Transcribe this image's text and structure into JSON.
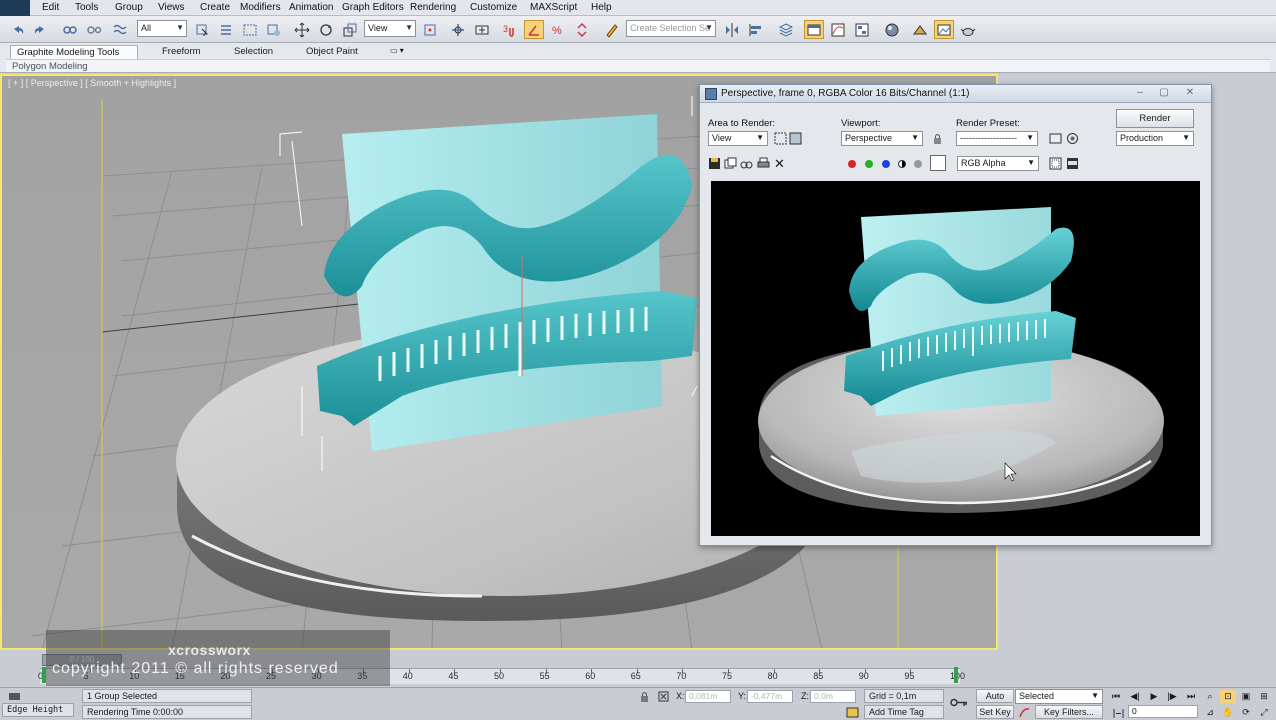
{
  "menu": [
    "Edit",
    "Tools",
    "Group",
    "Views",
    "Create",
    "Modifiers",
    "Animation",
    "Graph Editors",
    "Rendering",
    "Customize",
    "MAXScript",
    "Help"
  ],
  "toolbar": {
    "selection_filter": "All",
    "reference_coord": "View",
    "named_selection_placeholder": "Create Selection Se"
  },
  "ribbon": {
    "tabs": [
      "Graphite Modeling Tools",
      "Freeform",
      "Selection",
      "Object Paint"
    ],
    "panel_label": "Polygon Modeling"
  },
  "viewport": {
    "label": "[ + ] [ Perspective ] [ Smooth + Highlights ]"
  },
  "render_window": {
    "title": "Perspective, frame 0, RGBA Color 16 Bits/Channel (1:1)",
    "area_label": "Area to Render:",
    "area_value": "View",
    "viewport_label": "Viewport:",
    "viewport_value": "Perspective",
    "preset_label": "Render Preset:",
    "preset_value": "-------------------",
    "render_button": "Render",
    "mode_value": "Production",
    "channel_value": "RGB Alpha"
  },
  "timeline": {
    "frame_counter": "0 / 100",
    "ticks": [
      "0",
      "5",
      "10",
      "15",
      "20",
      "25",
      "30",
      "35",
      "40",
      "45",
      "50",
      "55",
      "60",
      "65",
      "70",
      "75",
      "80",
      "85",
      "90",
      "95",
      "100"
    ],
    "current_frame": 0
  },
  "watermark": {
    "brand": "xcrossworx",
    "copyright": "copyright 2011 © all rights reserved"
  },
  "status": {
    "maxscript_listener": "Edge Height",
    "selection_info": "1 Group Selected",
    "prompt": "Rendering Time  0:00:00",
    "x_label": "X:",
    "x_value": "0,081m",
    "y_label": "Y:",
    "y_value": "-0,477m",
    "z_label": "Z:",
    "z_value": "0,0m",
    "grid": "Grid = 0,1m",
    "add_time_tag": "Add Time Tag",
    "auto_key": "Auto Key",
    "set_key": "Set Key",
    "key_mode": "Selected",
    "key_filters": "Key Filters...",
    "frame_field": "0"
  }
}
